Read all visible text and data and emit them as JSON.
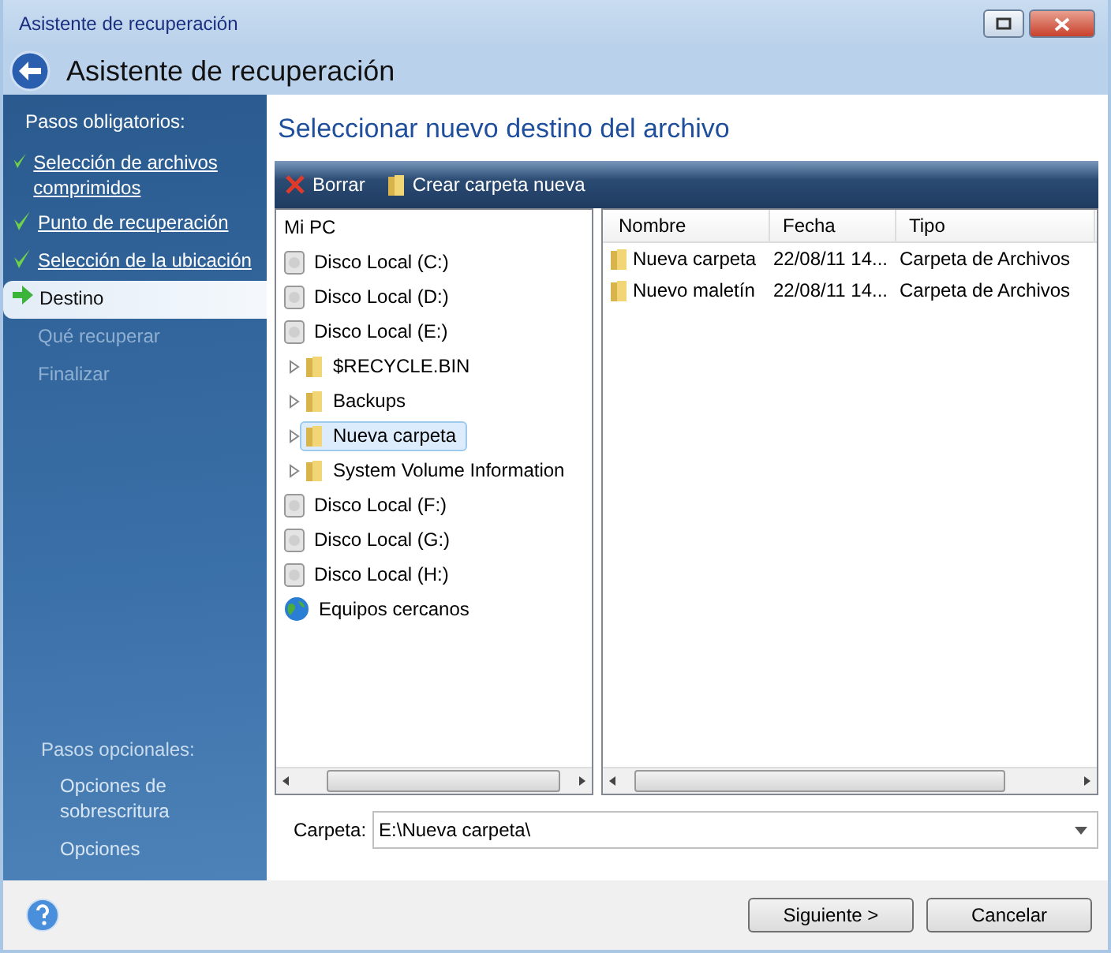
{
  "window": {
    "title": "Asistente de recuperación"
  },
  "header": {
    "title": "Asistente de recuperación"
  },
  "sidebar": {
    "required_heading": "Pasos obligatorios:",
    "steps": [
      {
        "label": "Selección de archivos comprimidos",
        "kind": "done"
      },
      {
        "label": "Punto de recuperación",
        "kind": "done"
      },
      {
        "label": "Selección de la ubicación",
        "kind": "done"
      },
      {
        "label": "Destino",
        "kind": "current"
      },
      {
        "label": "Qué recuperar",
        "kind": "pending"
      },
      {
        "label": "Finalizar",
        "kind": "pending"
      }
    ],
    "optional_heading": "Pasos opcionales:",
    "optional_steps": [
      {
        "label": "Opciones de sobrescritura"
      },
      {
        "label": "Opciones"
      }
    ]
  },
  "content": {
    "title": "Seleccionar nuevo destino del archivo",
    "toolbar": [
      {
        "label": "Borrar",
        "kind": "delete"
      },
      {
        "label": "Crear carpeta nueva",
        "kind": "folder"
      }
    ],
    "tree": {
      "root": "Mi PC",
      "items": [
        {
          "label": "Disco Local (C:)",
          "kind": "drive",
          "selected": false
        },
        {
          "label": "Disco Local (D:)",
          "kind": "drive",
          "selected": false
        },
        {
          "label": "Disco Local (E:)",
          "kind": "drive",
          "selected": false,
          "children": [
            {
              "label": "$RECYCLE.BIN",
              "kind": "folder",
              "selected": false
            },
            {
              "label": "Backups",
              "kind": "folder",
              "selected": false
            },
            {
              "label": "Nueva carpeta",
              "kind": "folder",
              "selected": true
            },
            {
              "label": "System Volume Information",
              "kind": "folder",
              "selected": false
            }
          ]
        },
        {
          "label": "Disco Local (F:)",
          "kind": "drive",
          "selected": false
        },
        {
          "label": "Disco Local (G:)",
          "kind": "drive",
          "selected": false
        },
        {
          "label": "Disco Local (H:)",
          "kind": "drive",
          "selected": false
        },
        {
          "label": "Equipos cercanos",
          "kind": "network",
          "selected": false
        }
      ]
    },
    "list": {
      "columns": [
        "Nombre",
        "Fecha",
        "Tipo"
      ],
      "rows": [
        [
          "Nueva carpeta",
          "22/08/11 14...",
          "Carpeta de Archivos"
        ],
        [
          "Nuevo maletín",
          "22/08/11 14...",
          "Carpeta de Archivos"
        ]
      ]
    },
    "folder_field": {
      "label": "Carpeta:",
      "value": "E:\\Nueva carpeta\\"
    }
  },
  "buttons": [
    "Siguiente >",
    "Cancelar"
  ]
}
